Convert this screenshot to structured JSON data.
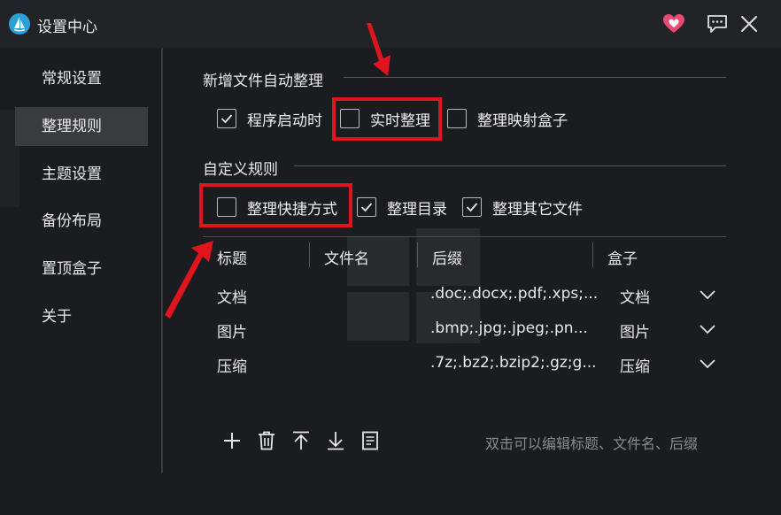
{
  "window": {
    "title": "设置中心"
  },
  "sidebar": {
    "items": [
      {
        "label": "常规设置",
        "active": false
      },
      {
        "label": "整理规则",
        "active": true
      },
      {
        "label": "主题设置",
        "active": false
      },
      {
        "label": "备份布局",
        "active": false
      },
      {
        "label": "置顶盒子",
        "active": false
      },
      {
        "label": "关于",
        "active": false
      }
    ]
  },
  "sections": {
    "auto": {
      "title": "新增文件自动整理",
      "options": [
        {
          "label": "程序启动时",
          "checked": true
        },
        {
          "label": "实时整理",
          "checked": false
        },
        {
          "label": "整理映射盒子",
          "checked": false
        }
      ]
    },
    "custom": {
      "title": "自定义规则",
      "options": [
        {
          "label": "整理快捷方式",
          "checked": false
        },
        {
          "label": "整理目录",
          "checked": true
        },
        {
          "label": "整理其它文件",
          "checked": true
        }
      ]
    }
  },
  "table": {
    "headers": [
      "标题",
      "文件名",
      "后缀",
      "盒子"
    ],
    "rows": [
      {
        "title": "文档",
        "filename": "",
        "suffix": ".doc;.docx;.pdf;.xps;...",
        "box": "文档"
      },
      {
        "title": "图片",
        "filename": "",
        "suffix": ".bmp;.jpg;.jpeg;.pn...",
        "box": "图片"
      },
      {
        "title": "压缩",
        "filename": "",
        "suffix": ".7z;.bz2;.bzip2;.gz;g...",
        "box": "压缩"
      }
    ]
  },
  "footer": {
    "hint": "双击可以编辑标题、文件名、后缀"
  },
  "icons": {
    "logo": "sail-logo-icon",
    "heart": "heart-icon",
    "feedback": "feedback-icon",
    "close": "close-icon",
    "add": "plus-icon",
    "delete": "trash-icon",
    "move_top": "move-top-icon",
    "move_bottom": "move-bottom-icon",
    "edit": "document-icon"
  },
  "colors": {
    "background": "#1b1c1f",
    "titlebar": "#222327",
    "active_item": "#3a3b3f",
    "accent_heart": "#e94a71",
    "logo": "#2a9fd8",
    "annotation_red": "#e0141c"
  }
}
